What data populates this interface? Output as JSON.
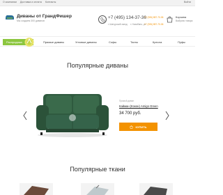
{
  "topbar": {
    "links": [
      "О компании",
      "Доставка и оплата",
      "Контакты"
    ],
    "login": "Войти"
  },
  "header": {
    "brand": "Диваны от ГрандФишер",
    "tagline": "Мы создаем 300 диванов",
    "phone_main": "+7 (495) 134-37-36",
    "address_1": "г. Шатурский заезд",
    "address_2": "г. Нахабино, ул.",
    "phone_small_1": "+7 (926) 857-70-06",
    "phone_small_2": "+7 (926) 857-70-06"
  },
  "cart": {
    "title": "Корзина",
    "subtitle": "Выбрано товара"
  },
  "nav": {
    "sale": "Распродажа",
    "items": [
      "Прямые диваны",
      "Угловые диваны",
      "Софы",
      "Тахты",
      "Кресла",
      "Пуфы"
    ]
  },
  "popular_sofas": {
    "title": "Популярные диваны"
  },
  "product": {
    "label": "Прямой диван",
    "name": "Кайман (Кокон) Amigo Green",
    "price": "34 700 руб.",
    "buy_label": "КУПИТЬ"
  },
  "popular_fabrics": {
    "title": "Популярные ткани"
  },
  "colors": {
    "accent": "#f39200",
    "sale": "#8cc63f",
    "sofa": "#2f5a3f"
  }
}
